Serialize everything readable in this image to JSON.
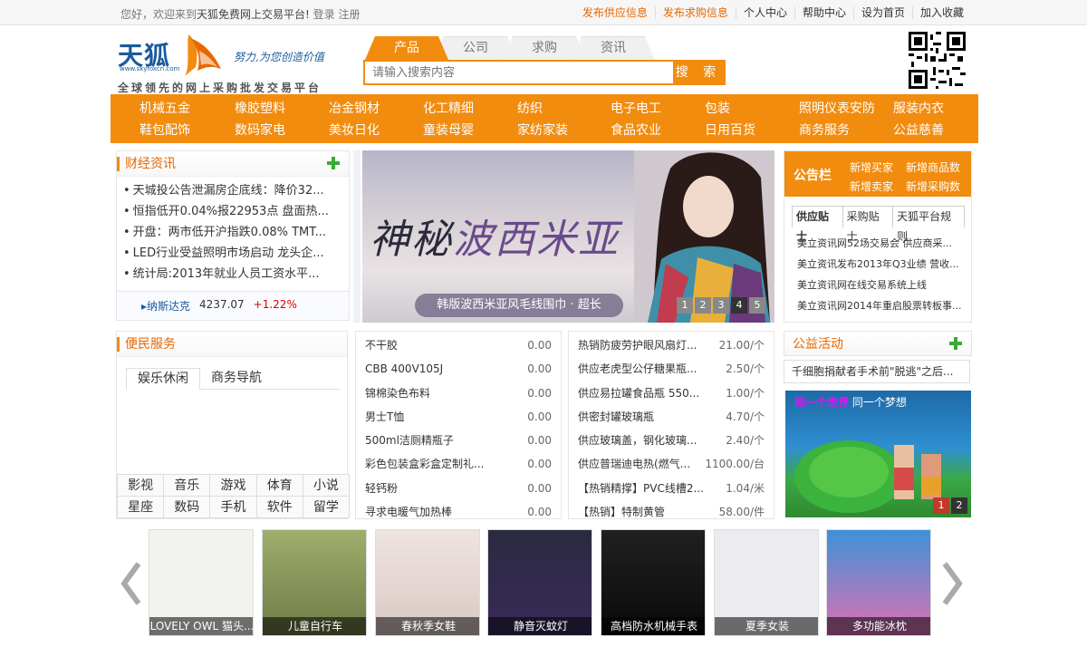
{
  "topbar": {
    "welcome_prefix": "您好，欢迎来到",
    "brand": "天狐免费网上交易平台!",
    "login": "登录",
    "register": "注册",
    "links": [
      {
        "label": "发布供应信息",
        "highlight": true
      },
      {
        "label": "发布求购信息",
        "highlight": true
      },
      {
        "label": "个人中心",
        "highlight": false
      },
      {
        "label": "帮助中心",
        "highlight": false
      },
      {
        "label": "设为首页",
        "highlight": false
      },
      {
        "label": "加入收藏",
        "highlight": false
      }
    ]
  },
  "logo": {
    "name": "天狐",
    "url": "www.skyfoxcn.com",
    "slogan": "努力,为您创造价值",
    "tagline": "全球领先的网上采购批发交易平台"
  },
  "search": {
    "tabs": [
      "产品",
      "公司",
      "求购",
      "资讯"
    ],
    "active_tab": "产品",
    "placeholder": "请输入搜索内容",
    "button": "搜 索"
  },
  "categories": {
    "row1": [
      "机械五金",
      "橡胶塑料",
      "冶金钢材",
      "化工精细",
      "纺织",
      "电子电工",
      "包装",
      "照明仪表安防",
      "服装内衣"
    ],
    "row2": [
      "鞋包配饰",
      "数码家电",
      "美妆日化",
      "童装母婴",
      "家纺家装",
      "食品农业",
      "日用百货",
      "商务服务",
      "公益慈善"
    ]
  },
  "finance": {
    "title": "财经资讯",
    "items": [
      "天城投公告泄漏房企底线：降价32...",
      "恒指低开0.04%报22953点 盘面热...",
      "开盘：两市低开沪指跌0.08% TMT...",
      "LED行业受益照明市场启动 龙头企...",
      "统计局:2013年就业人员工资水平..."
    ],
    "index_name": "纳斯达克",
    "index_value": "4237.07",
    "index_change": "+1.22%"
  },
  "banner": {
    "title_a": "神秘",
    "title_b": "波西米亚",
    "caption": "韩版波西米亚风毛线围巾 · 超长",
    "pages": [
      "1",
      "2",
      "3",
      "4",
      "5"
    ],
    "active_page": "4"
  },
  "notice": {
    "title": "公告栏",
    "links": [
      "新增买家",
      "新增商品数",
      "新增卖家",
      "新增采购数"
    ],
    "tabs": [
      "供应贴士",
      "采购贴士",
      "天狐平台规则"
    ],
    "active_tab": "供应贴士",
    "items": [
      "美立资讯网52场交易会 供应商采...",
      "美立资讯发布2013年Q3业绩 营收...",
      "美立资讯网在线交易系统上线",
      "美立资讯网2014年重启股票转板事..."
    ]
  },
  "services": {
    "title": "便民服务",
    "tabs": [
      "娱乐休闲",
      "商务导航"
    ],
    "active_tab": "娱乐休闲",
    "grid": [
      "影视",
      "音乐",
      "游戏",
      "体育",
      "小说",
      "星座",
      "数码",
      "手机",
      "软件",
      "留学"
    ]
  },
  "product_list_1": [
    {
      "name": "不干胶",
      "price": "0.00"
    },
    {
      "name": "CBB 400V105J",
      "price": "0.00"
    },
    {
      "name": "锦棉染色布料",
      "price": "0.00"
    },
    {
      "name": "男士T恤",
      "price": "0.00"
    },
    {
      "name": "500ml洁厕精瓶子",
      "price": "0.00"
    },
    {
      "name": "彩色包装盒彩盒定制礼...",
      "price": "0.00"
    },
    {
      "name": "轻钙粉",
      "price": "0.00"
    },
    {
      "name": "寻求电暖气加热棒",
      "price": "0.00"
    }
  ],
  "product_list_2": [
    {
      "name": "热销防疲劳护眼风扇灯...",
      "price": "21.00/个"
    },
    {
      "name": "供应老虎型公仔糖果瓶...",
      "price": "2.50/个"
    },
    {
      "name": "供应易拉罐食品瓶 550...",
      "price": "1.00/个"
    },
    {
      "name": "供密封罐玻璃瓶",
      "price": "4.70/个"
    },
    {
      "name": "供应玻璃盖，钢化玻璃...",
      "price": "2.40/个"
    },
    {
      "name": "供应普瑞迪电热(燃气...",
      "price": "1100.00/台"
    },
    {
      "name": "【热销精撑】PVC线槽2...",
      "price": "1.04/米"
    },
    {
      "name": "【热销】特制黄管",
      "price": "58.00/件"
    }
  ],
  "welfare": {
    "title": "公益活动",
    "item": "千细胞捐献者手术前\"脱逃\"之后...",
    "image_text_a": "同一个世界",
    "image_text_b": "同一个梦想",
    "pages": [
      "1",
      "2"
    ],
    "active_page": "1"
  },
  "carousel": [
    {
      "caption": "LOVELY OWL 猫头...",
      "color": "#f2f2ee"
    },
    {
      "caption": "儿童自行车",
      "color": "#7c8a55"
    },
    {
      "caption": "春秋季女鞋",
      "color": "#e8dad5"
    },
    {
      "caption": "静音灭蚊灯",
      "color": "#2a2a40"
    },
    {
      "caption": "高档防水机械手表",
      "color": "#151515"
    },
    {
      "caption": "夏季女装",
      "color": "#ececf0"
    },
    {
      "caption": "多功能冰枕",
      "color": "#3d92d8"
    }
  ],
  "colors": {
    "accent": "#f28c0f",
    "brand_blue": "#1a5a9e",
    "plus_green": "#3aaa35"
  }
}
